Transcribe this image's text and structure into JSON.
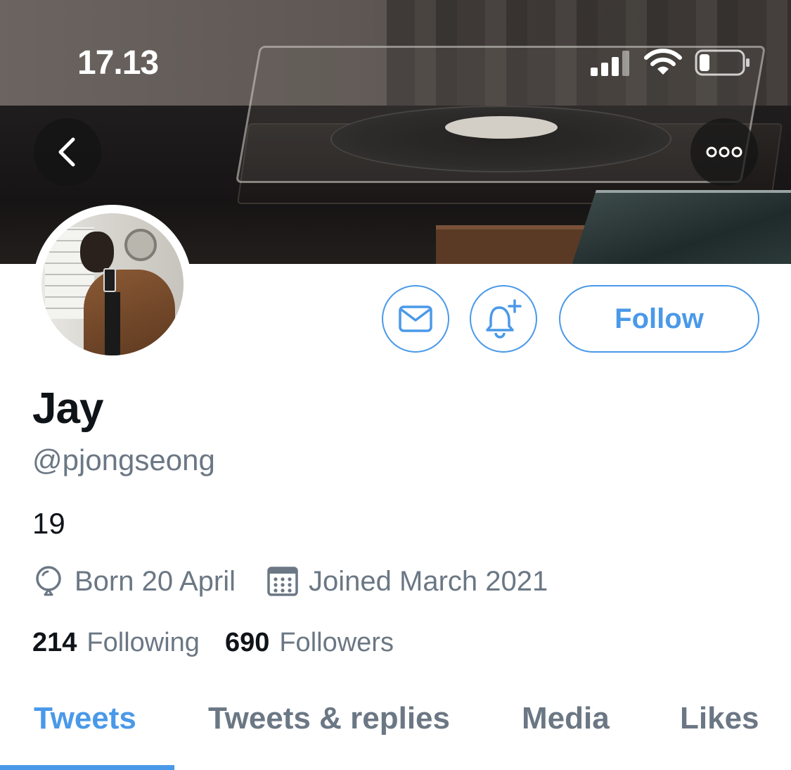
{
  "status_bar": {
    "time": "17.13"
  },
  "header": {
    "back_icon": "chevron-left-icon",
    "more_icon": "more-horizontal-icon"
  },
  "profile": {
    "display_name": "Jay",
    "handle": "@pjongseong",
    "bio": "19",
    "birthday": "Born 20 April",
    "joined": "Joined March 2021",
    "following_count": "214",
    "following_label": "Following",
    "followers_count": "690",
    "followers_label": "Followers"
  },
  "actions": {
    "message_icon": "envelope-icon",
    "notify_icon": "bell-plus-icon",
    "follow_label": "Follow"
  },
  "tabs": [
    {
      "label": "Tweets",
      "active": true
    },
    {
      "label": "Tweets & replies",
      "active": false
    },
    {
      "label": "Media",
      "active": false
    },
    {
      "label": "Likes",
      "active": false
    }
  ],
  "colors": {
    "accent": "#4a99e9",
    "secondary_text": "#6b7784",
    "primary_text": "#0f1419"
  }
}
